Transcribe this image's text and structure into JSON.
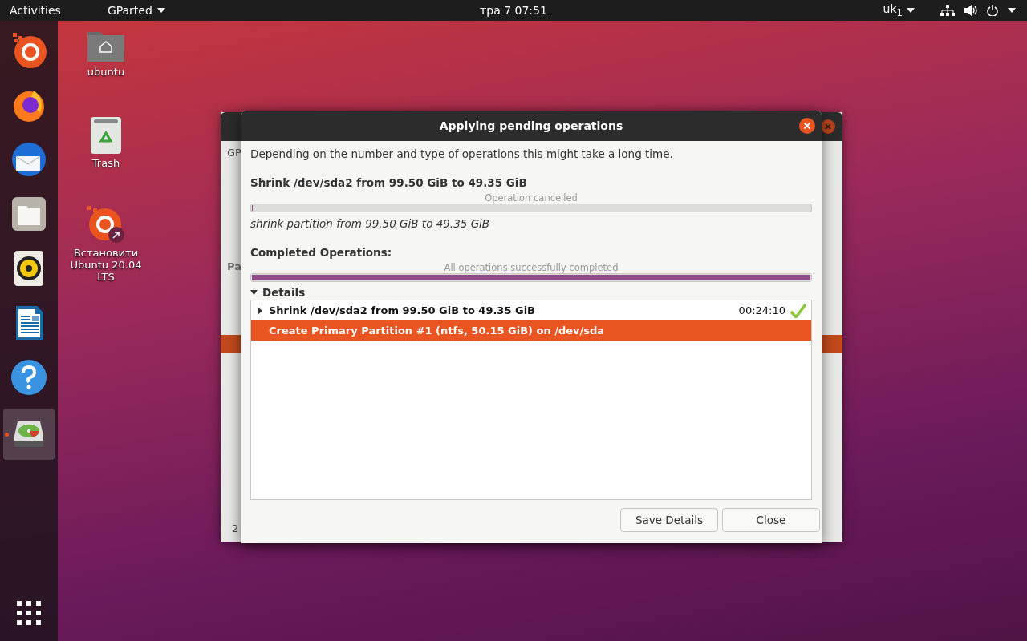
{
  "top_bar": {
    "activities": "Activities",
    "app_menu": "GParted",
    "clock": "тра 7  07:51",
    "keyboard": "uk$_{1}$"
  },
  "dock": {
    "items": [
      {
        "kind": "installer",
        "selected": false,
        "running": false
      },
      {
        "kind": "firefox",
        "selected": false,
        "running": false
      },
      {
        "kind": "mail",
        "selected": false,
        "running": false
      },
      {
        "kind": "files",
        "selected": false,
        "running": false
      },
      {
        "kind": "speaker",
        "selected": false,
        "running": false
      },
      {
        "kind": "writer",
        "selected": false,
        "running": false
      },
      {
        "kind": "help",
        "selected": false,
        "running": false
      },
      {
        "kind": "disk",
        "selected": true,
        "running": true
      }
    ]
  },
  "desktop_icons": [
    {
      "kind": "home",
      "label": "ubuntu"
    },
    {
      "kind": "trash",
      "label": "Trash"
    },
    {
      "kind": "installer",
      "label": "Встановити Ubuntu 20.04 LTS"
    }
  ],
  "background_window": {
    "title_fragment": "GP",
    "panel_fragment": "Pa",
    "status_fragment": "2"
  },
  "dialog": {
    "title": "Applying pending operations",
    "description": "Depending on the number and type of operations this might take a long time.",
    "current_operation": {
      "title": "Shrink /dev/sda2 from 99.50 GiB to 49.35 GiB",
      "status": "Operation cancelled",
      "level": 0,
      "step": "shrink partition from 99.50 GiB to 49.35 GiB"
    },
    "completed": {
      "title": "Completed Operations:",
      "status": "All operations successfully completed",
      "level": 1
    },
    "details": {
      "label": "Details",
      "expanded": true,
      "rows": [
        {
          "text": "Shrink /dev/sda2 from 99.50 GiB to 49.35 GiB",
          "time": "00:24:10",
          "done": true,
          "has_children": true,
          "selected": false
        },
        {
          "text": "Create Primary Partition #1 (ntfs, 50.15 GiB) on /dev/sda",
          "time": "",
          "done": false,
          "has_children": false,
          "selected": true
        }
      ]
    },
    "buttons": [
      "Save Details",
      "Close"
    ]
  }
}
